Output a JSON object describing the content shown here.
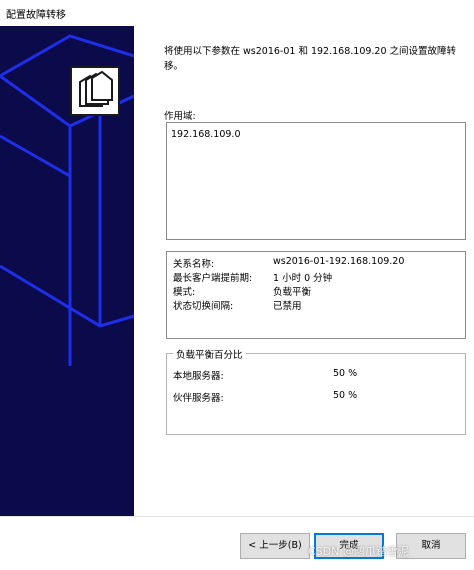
{
  "window": {
    "title": "配置故障转移"
  },
  "content": {
    "description": "将使用以下参数在 ws2016-01 和 192.168.109.20 之间设置故障转移。",
    "scope_label": "作用域:",
    "scope_items": [
      "192.168.109.0"
    ],
    "info": [
      {
        "key": "关系名称:",
        "value": "ws2016-01-192.168.109.20"
      },
      {
        "key": "最长客户端提前期:",
        "value": "1 小时 0 分钟"
      },
      {
        "key": "模式:",
        "value": "负载平衡"
      },
      {
        "key": "状态切换间隔:",
        "value": "已禁用"
      }
    ],
    "load_balance": {
      "legend": "负载平衡百分比",
      "local_label": "本地服务器:",
      "local_value": "50 %",
      "partner_label": "伙伴服务器:",
      "partner_value": "50 %"
    }
  },
  "footer": {
    "back_label": "< 上一步(B)",
    "finish_label": "完成",
    "cancel_label": "取消"
  },
  "watermark": "CSDN @鸿爪踏雪泥",
  "colors": {
    "banner": "#0b0a4a",
    "banner_lines": "#1f2ee8",
    "default_button_border": "#0078d7"
  },
  "icons": {
    "banner": "folders-icon"
  }
}
